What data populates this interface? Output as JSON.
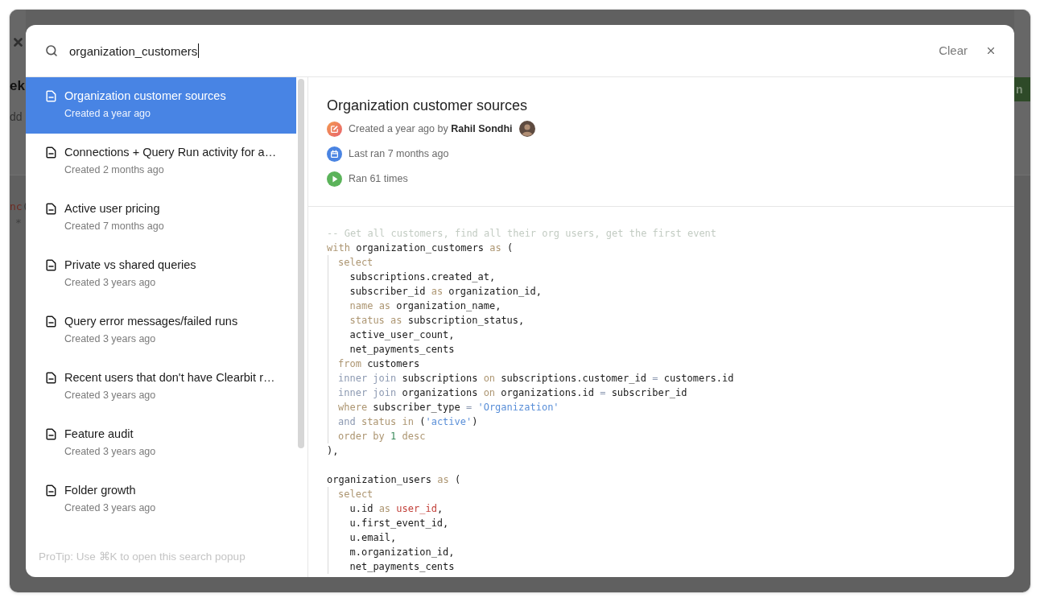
{
  "backdrop": {
    "heading": "ek",
    "text": "dd",
    "code": [
      {
        "text": "nc",
        "kind": "function"
      },
      {
        "text": "(",
        "kind": "punctuation",
        "tight": true
      }
    ],
    "code_mark": "*",
    "button_label": "n"
  },
  "search": {
    "value": "organization_customers",
    "focused": true,
    "clear_label": "Clear"
  },
  "results": [
    {
      "title": "Organization customer sources",
      "subtitle": "Created a year ago",
      "selected": true
    },
    {
      "title": "Connections + Query Run activity for a…",
      "subtitle": "Created 2 months ago",
      "selected": false
    },
    {
      "title": "Active user pricing",
      "subtitle": "Created 7 months ago",
      "selected": false
    },
    {
      "title": "Private vs shared queries",
      "subtitle": "Created 3 years ago",
      "selected": false
    },
    {
      "title": "Query error messages/failed runs",
      "subtitle": "Created 3 years ago",
      "selected": false
    },
    {
      "title": "Recent users that don't have Clearbit r…",
      "subtitle": "Created 3 years ago",
      "selected": false
    },
    {
      "title": "Feature audit",
      "subtitle": "Created 3 years ago",
      "selected": false
    },
    {
      "title": "Folder growth",
      "subtitle": "Created 3 years ago",
      "selected": false
    }
  ],
  "protip": "ProTip: Use ⌘K to open this search popup",
  "detail": {
    "title": "Organization customer sources",
    "meta": [
      {
        "kind": "created",
        "text": "Created a year ago by **Rahil Sondhi**"
      },
      {
        "kind": "last_ran",
        "text": "Last ran 7 months ago"
      },
      {
        "kind": "runs",
        "text": "Ran 61 times"
      }
    ],
    "code": {
      "sections": [
        [
          {
            "tokens": [
              {
                "text": "-- Get all customers, find all their org users, get the first event",
                "kind": "comment"
              }
            ]
          },
          {
            "tokens": [
              {
                "text": "with",
                "kind": "keyword"
              },
              {
                "text": "organization_customers",
                "kind": "identifier"
              },
              {
                "text": "as",
                "kind": "keyword"
              },
              {
                "text": "(",
                "kind": "punctuation"
              }
            ],
            "children": [
              {
                "tokens": [
                  {
                    "text": "select",
                    "kind": "keyword"
                  }
                ],
                "children": [
                  {
                    "tokens": [
                      {
                        "text": "subscriptions.created_at,",
                        "kind": "identifier"
                      }
                    ]
                  },
                  {
                    "tokens": [
                      {
                        "text": "subscriber_id",
                        "kind": "identifier"
                      },
                      {
                        "text": "as",
                        "kind": "keyword"
                      },
                      {
                        "text": "organization_id,",
                        "kind": "identifier"
                      }
                    ]
                  },
                  {
                    "tokens": [
                      {
                        "text": "name",
                        "kind": "keyword"
                      },
                      {
                        "text": "as",
                        "kind": "keyword"
                      },
                      {
                        "text": "organization_name,",
                        "kind": "identifier"
                      }
                    ]
                  },
                  {
                    "tokens": [
                      {
                        "text": "status",
                        "kind": "keyword"
                      },
                      {
                        "text": "as",
                        "kind": "keyword"
                      },
                      {
                        "text": "subscription_status,",
                        "kind": "identifier"
                      }
                    ]
                  },
                  {
                    "tokens": [
                      {
                        "text": "active_user_count,",
                        "kind": "identifier"
                      }
                    ]
                  },
                  {
                    "tokens": [
                      {
                        "text": "net_payments_cents",
                        "kind": "identifier"
                      }
                    ]
                  }
                ]
              },
              {
                "tokens": [
                  {
                    "text": "from",
                    "kind": "keyword"
                  },
                  {
                    "text": "customers",
                    "kind": "identifier"
                  }
                ]
              },
              {
                "tokens": [
                  {
                    "text": "inner join",
                    "kind": "operator"
                  },
                  {
                    "text": "subscriptions",
                    "kind": "identifier"
                  },
                  {
                    "text": "on",
                    "kind": "keyword"
                  },
                  {
                    "text": "subscriptions.customer_id",
                    "kind": "identifier"
                  },
                  {
                    "text": "=",
                    "kind": "operator"
                  },
                  {
                    "text": "customers.id",
                    "kind": "identifier"
                  }
                ]
              },
              {
                "tokens": [
                  {
                    "text": "inner join",
                    "kind": "operator"
                  },
                  {
                    "text": "organizations",
                    "kind": "identifier"
                  },
                  {
                    "text": "on",
                    "kind": "keyword"
                  },
                  {
                    "text": "organizations.id",
                    "kind": "identifier"
                  },
                  {
                    "text": "=",
                    "kind": "operator"
                  },
                  {
                    "text": "subscriber_id",
                    "kind": "identifier"
                  }
                ]
              },
              {
                "tokens": [
                  {
                    "text": "where",
                    "kind": "keyword"
                  },
                  {
                    "text": "subscriber_type",
                    "kind": "identifier"
                  },
                  {
                    "text": "=",
                    "kind": "operator"
                  },
                  {
                    "text": "'Organization'",
                    "kind": "string"
                  }
                ]
              },
              {
                "tokens": [
                  {
                    "text": "and",
                    "kind": "operator"
                  },
                  {
                    "text": "status",
                    "kind": "keyword"
                  },
                  {
                    "text": "in",
                    "kind": "keyword"
                  },
                  {
                    "text": "(",
                    "kind": "punctuation"
                  },
                  {
                    "text": "'active'",
                    "kind": "string",
                    "tight": true
                  },
                  {
                    "text": ")",
                    "kind": "punctuation",
                    "tight": true
                  }
                ]
              },
              {
                "tokens": [
                  {
                    "text": "order by",
                    "kind": "keyword"
                  },
                  {
                    "text": "1",
                    "kind": "number"
                  },
                  {
                    "text": "desc",
                    "kind": "keyword"
                  }
                ]
              }
            ]
          },
          {
            "tokens": [
              {
                "text": "),",
                "kind": "punctuation"
              }
            ]
          }
        ],
        [
          {
            "tokens": [
              {
                "text": "organization_users",
                "kind": "identifier"
              },
              {
                "text": "as",
                "kind": "keyword"
              },
              {
                "text": "(",
                "kind": "punctuation"
              }
            ],
            "children": [
              {
                "tokens": [
                  {
                    "text": "select",
                    "kind": "keyword"
                  }
                ],
                "children": [
                  {
                    "tokens": [
                      {
                        "text": "u.id",
                        "kind": "identifier"
                      },
                      {
                        "text": "as",
                        "kind": "keyword"
                      },
                      {
                        "text": "user_id",
                        "kind": "alias"
                      },
                      {
                        "text": ",",
                        "kind": "punctuation",
                        "tight": true
                      }
                    ]
                  },
                  {
                    "tokens": [
                      {
                        "text": "u.first_event_id,",
                        "kind": "identifier"
                      }
                    ]
                  },
                  {
                    "tokens": [
                      {
                        "text": "u.email,",
                        "kind": "identifier"
                      }
                    ]
                  },
                  {
                    "tokens": [
                      {
                        "text": "m.organization_id,",
                        "kind": "identifier"
                      }
                    ]
                  },
                  {
                    "tokens": [
                      {
                        "text": "net_payments_cents",
                        "kind": "identifier"
                      }
                    ]
                  }
                ]
              }
            ]
          }
        ]
      ]
    }
  }
}
